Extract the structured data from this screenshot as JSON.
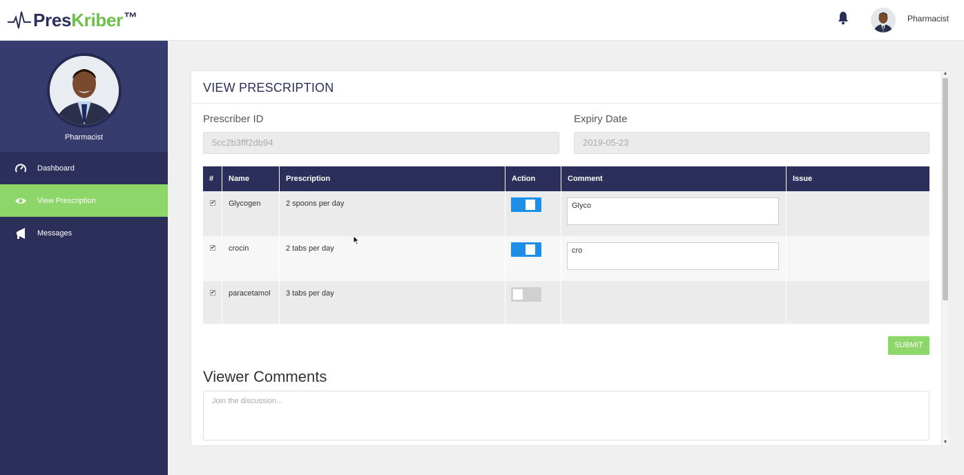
{
  "app": {
    "logo_part1": "Pres",
    "logo_part2": "Kriber",
    "logo_tm": "™",
    "brand_primary": "#2b2f5a",
    "brand_accent": "#6cc04a"
  },
  "header": {
    "bell_icon": "bell-icon",
    "user_role": "Pharmacist"
  },
  "sidebar": {
    "profile_name": "Pharmacist",
    "items": [
      {
        "label": "Dashboard",
        "icon": "speedometer-icon",
        "active": false
      },
      {
        "label": "View Prescription",
        "icon": "eye-icon",
        "active": true
      },
      {
        "label": "Messages",
        "icon": "megaphone-icon",
        "active": false
      }
    ]
  },
  "main": {
    "title": "VIEW PRESCRIPTION",
    "prescriber_label": "Prescriber ID",
    "prescriber_value": "5cc2b3fff2db94",
    "expiry_label": "Expiry Date",
    "expiry_value": "2019-05-23",
    "table": {
      "headers": [
        "#",
        "Name",
        "Prescription",
        "Action",
        "Comment",
        "Issue"
      ],
      "rows": [
        {
          "checked": true,
          "name": "Glycogen",
          "prescription": "2 spoons per day",
          "action_on": true,
          "comment": "Glyco",
          "issue": ""
        },
        {
          "checked": true,
          "name": "crocin",
          "prescription": "2 tabs per day",
          "action_on": true,
          "comment": "cro",
          "issue": ""
        },
        {
          "checked": true,
          "name": "paracetamol",
          "prescription": "3 tabs per day",
          "action_on": false,
          "comment": null,
          "issue": ""
        }
      ]
    },
    "submit_label": "SUBMIT",
    "viewer_comments_title": "Viewer Comments",
    "viewer_comments_placeholder": "Join the discussion..."
  }
}
